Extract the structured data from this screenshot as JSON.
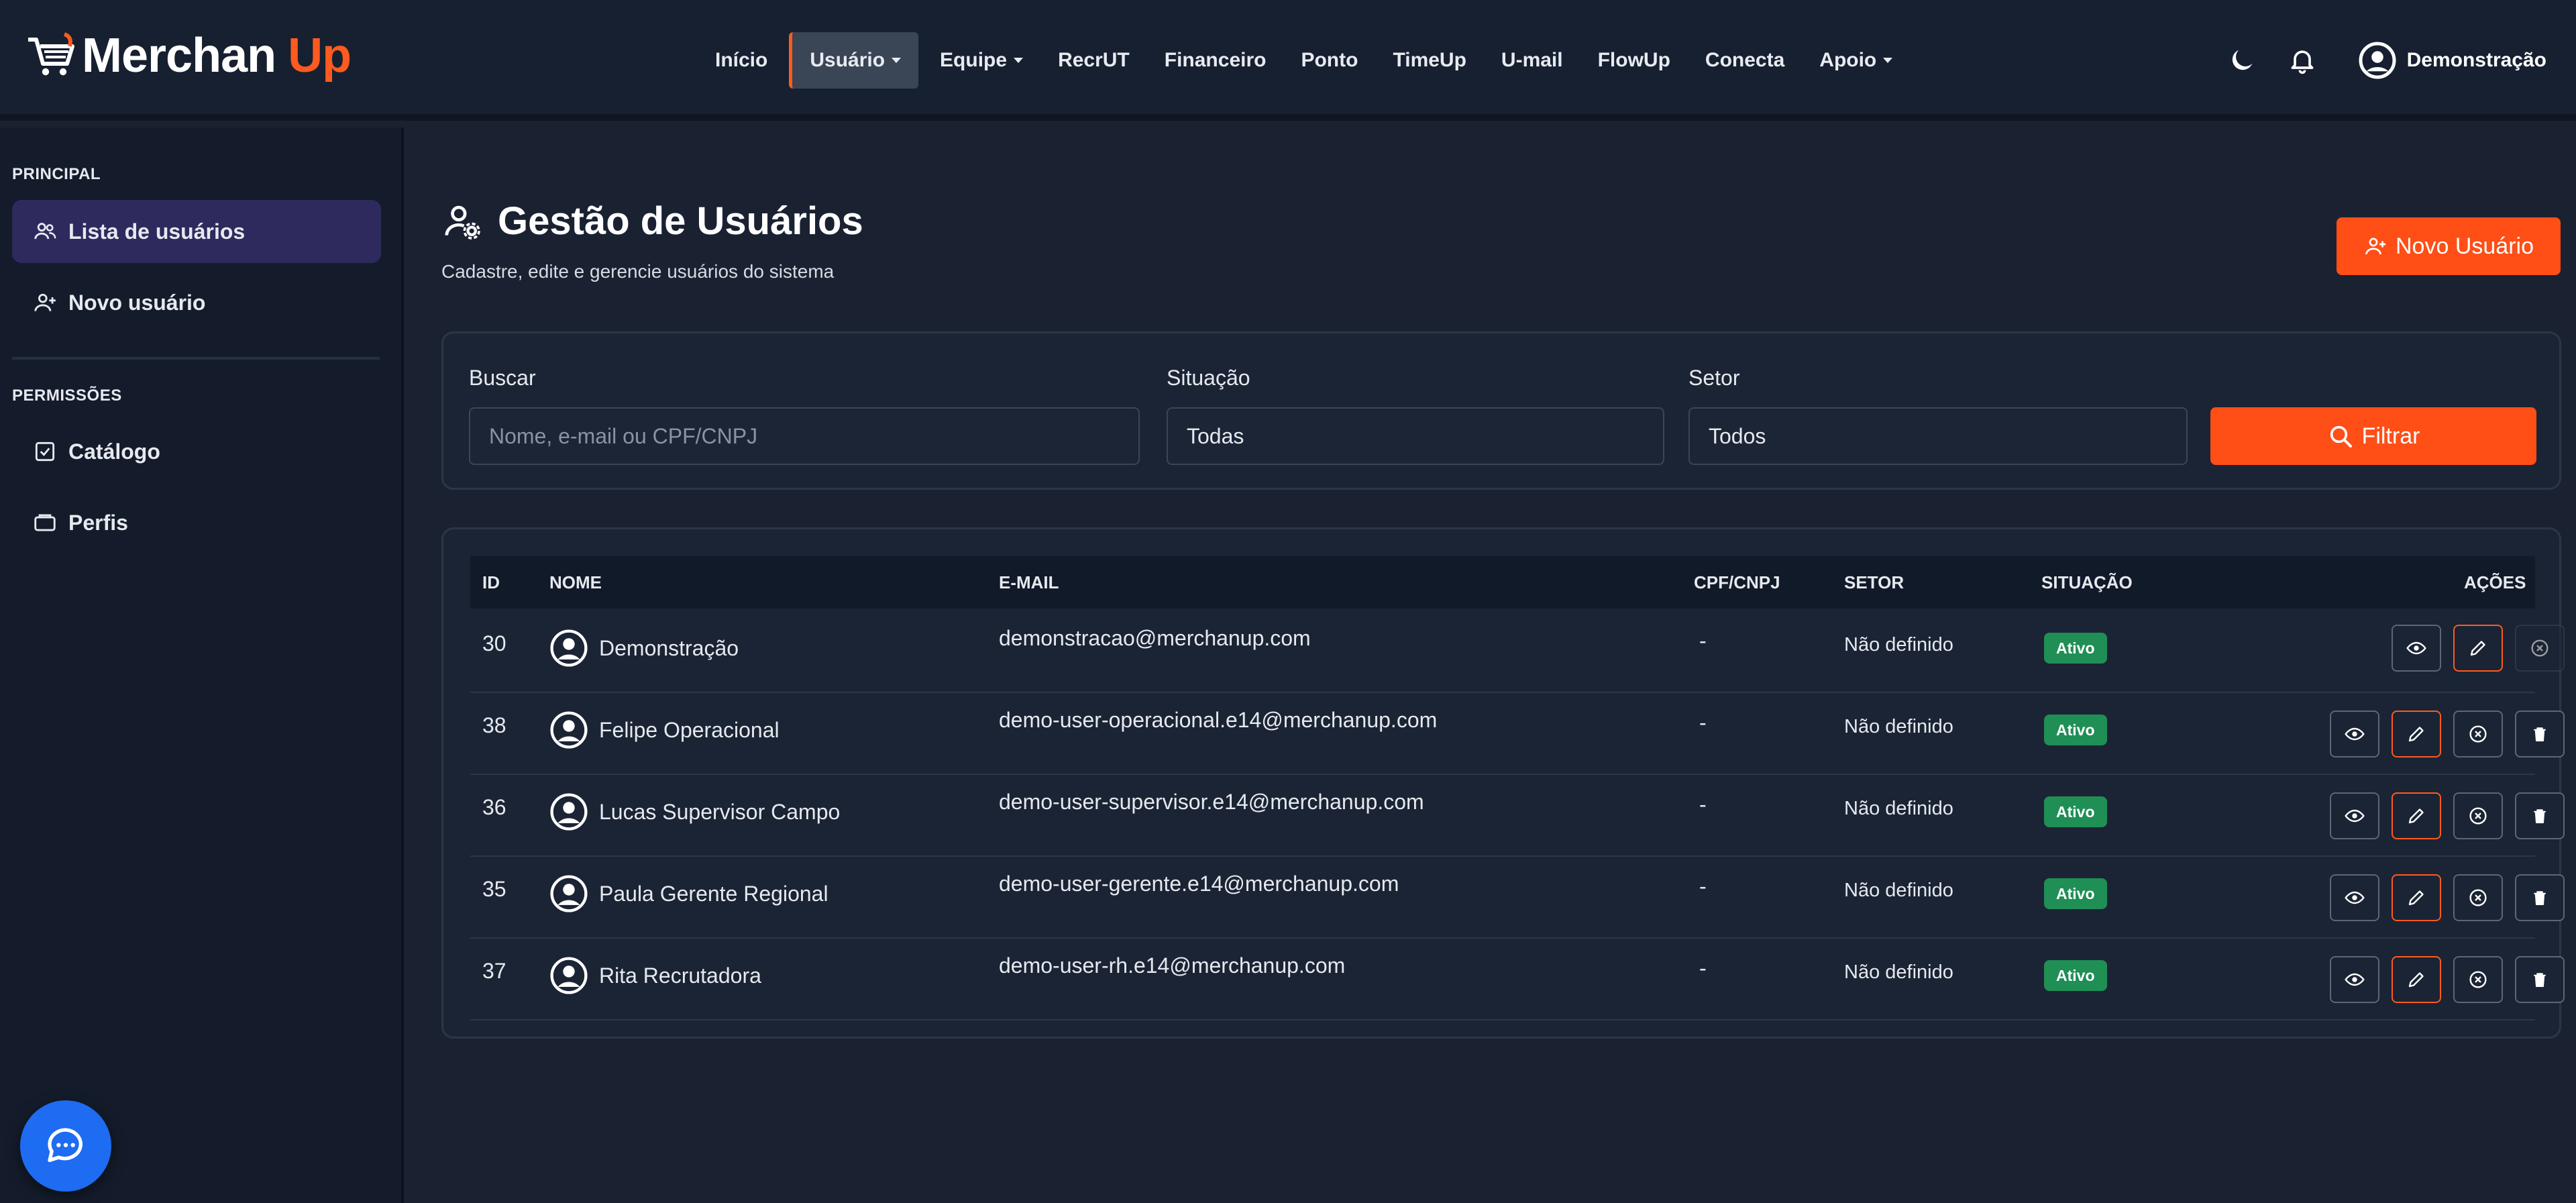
{
  "brand": {
    "part1": "Merchan",
    "part2": "Up"
  },
  "nav": {
    "items": [
      {
        "label": "Início",
        "dropdown": false,
        "active": false
      },
      {
        "label": "Usuário",
        "dropdown": true,
        "active": true
      },
      {
        "label": "Equipe",
        "dropdown": true,
        "active": false
      },
      {
        "label": "RecrUT",
        "dropdown": false,
        "active": false
      },
      {
        "label": "Financeiro",
        "dropdown": false,
        "active": false
      },
      {
        "label": "Ponto",
        "dropdown": false,
        "active": false
      },
      {
        "label": "TimeUp",
        "dropdown": false,
        "active": false
      },
      {
        "label": "U-mail",
        "dropdown": false,
        "active": false
      },
      {
        "label": "FlowUp",
        "dropdown": false,
        "active": false
      },
      {
        "label": "Conecta",
        "dropdown": false,
        "active": false
      },
      {
        "label": "Apoio",
        "dropdown": true,
        "active": false
      }
    ],
    "user": "Demonstração",
    "icons": [
      "moon-icon",
      "bell-icon",
      "user-circle-icon"
    ]
  },
  "sidebar": {
    "section1": "PRINCIPAL",
    "items1": [
      {
        "label": "Lista de usuários",
        "icon": "users-icon",
        "active": true
      },
      {
        "label": "Novo usuário",
        "icon": "user-plus-icon",
        "active": false
      }
    ],
    "section2": "PERMISSÕES",
    "items2": [
      {
        "label": "Catálogo",
        "icon": "checklist-icon",
        "active": false
      },
      {
        "label": "Perfis",
        "icon": "folder-icon",
        "active": false
      }
    ]
  },
  "page": {
    "title": "Gestão de Usuários",
    "subtitle": "Cadastre, edite e gerencie usuários do sistema",
    "new_user_button": "Novo Usuário"
  },
  "filters": {
    "search_label": "Buscar",
    "search_placeholder": "Nome, e-mail ou CPF/CNPJ",
    "status_label": "Situação",
    "status_value": "Todas",
    "sector_label": "Setor",
    "sector_value": "Todos",
    "filter_button": "Filtrar"
  },
  "table": {
    "headers": {
      "id": "ID",
      "name": "NOME",
      "email": "E-MAIL",
      "doc": "CPF/CNPJ",
      "sector": "SETOR",
      "status": "SITUAÇÃO",
      "actions": "AÇÕES"
    },
    "rows": [
      {
        "id": "30",
        "name": "Demonstração",
        "email": "demonstracao@merchanup.com",
        "doc": "-",
        "sector": "Não definido",
        "status": "Ativo",
        "deletable": false
      },
      {
        "id": "38",
        "name": "Felipe Operacional",
        "email": "demo-user-operacional.e14@merchanup.com",
        "doc": "-",
        "sector": "Não definido",
        "status": "Ativo",
        "deletable": true
      },
      {
        "id": "36",
        "name": "Lucas Supervisor Campo",
        "email": "demo-user-supervisor.e14@merchanup.com",
        "doc": "-",
        "sector": "Não definido",
        "status": "Ativo",
        "deletable": true
      },
      {
        "id": "35",
        "name": "Paula Gerente Regional",
        "email": "demo-user-gerente.e14@merchanup.com",
        "doc": "-",
        "sector": "Não definido",
        "status": "Ativo",
        "deletable": true
      },
      {
        "id": "37",
        "name": "Rita Recrutadora",
        "email": "demo-user-rh.e14@merchanup.com",
        "doc": "-",
        "sector": "Não definido",
        "status": "Ativo",
        "deletable": true
      }
    ]
  },
  "colors": {
    "accent": "#ff4e16",
    "background": "#1a2232",
    "active_badge": "#1f8f55",
    "chat_button": "#1d6cf2"
  }
}
